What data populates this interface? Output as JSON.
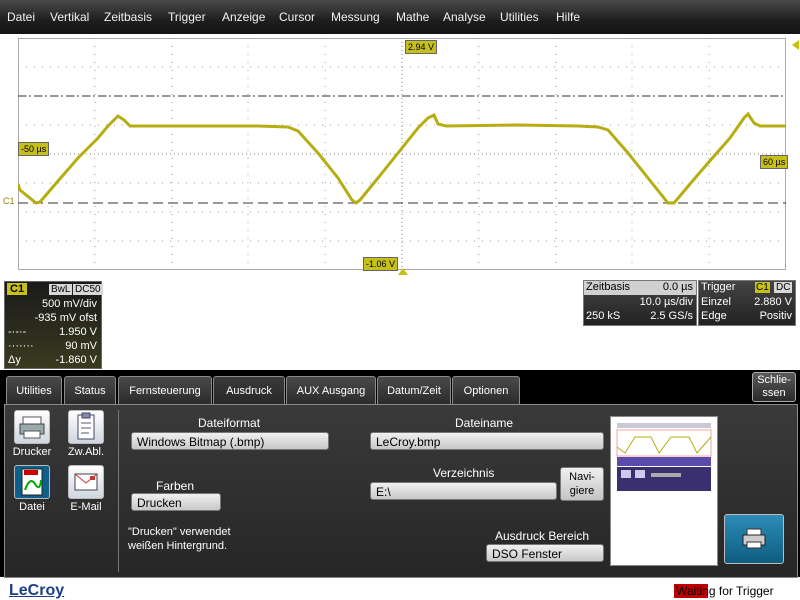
{
  "menu": [
    "Datei",
    "Vertikal",
    "Zeitbasis",
    "Trigger",
    "Anzeige",
    "Cursor",
    "Messung",
    "Mathe",
    "Analyse",
    "Utilities",
    "Hilfe"
  ],
  "scope": {
    "trace_color": "#b5ad12",
    "top_marker": "2.94 V",
    "bottom_marker": "-1.06 V",
    "left_marker": "-50 µs",
    "right_marker": "60 µs",
    "channel_marker": "C1"
  },
  "channel": {
    "name": "C1",
    "bwl": "BwL",
    "coupling": "DC50",
    "scale": "500 mV/div",
    "offset": "-935 mV ofst",
    "cursor1_label": "-·-·-",
    "cursor1": "1.950 V",
    "cursor2_label": "·······",
    "cursor2": "90 mV",
    "delta_label": "Δy",
    "delta": "-1.860 V"
  },
  "timebase": {
    "title": "Zeitbasis",
    "delay": "0.0 µs",
    "scale": "10.0 µs/div",
    "samples": "250 kS",
    "rate": "2.5 GS/s"
  },
  "trigger": {
    "title": "Trigger",
    "ch": "C1",
    "coupling": "DC",
    "mode": "Einzel",
    "level": "2.880 V",
    "type": "Edge",
    "slope": "Positiv"
  },
  "tabs": [
    "Utilities",
    "Status",
    "Fernsteuerung",
    "Ausdruck",
    "AUX Ausgang",
    "Datum/Zeit",
    "Optionen"
  ],
  "close_button": "Schlie-ssen",
  "icons": [
    {
      "label": "Drucker",
      "icon": "printer-icon"
    },
    {
      "label": "Zw.Abl.",
      "icon": "clipboard-icon"
    },
    {
      "label": "Datei",
      "icon": "file-icon"
    },
    {
      "label": "E-Mail",
      "icon": "email-icon"
    }
  ],
  "print": {
    "format_label": "Dateiformat",
    "format_value": "Windows Bitmap (.bmp)",
    "colors_label": "Farben",
    "colors_value": "Drucken",
    "note": "\"Drucken\" verwendet weißen Hintergrund.",
    "filename_label": "Dateiname",
    "filename_value": "LeCroy.bmp",
    "dir_label": "Verzeichnis",
    "dir_value": "E:\\",
    "navigate_button": "Navi-giere",
    "area_label": "Ausdruck Bereich",
    "area_value": "DSO Fenster"
  },
  "status": {
    "brand": "LeCroy",
    "message": "Waiting for Trigger"
  }
}
